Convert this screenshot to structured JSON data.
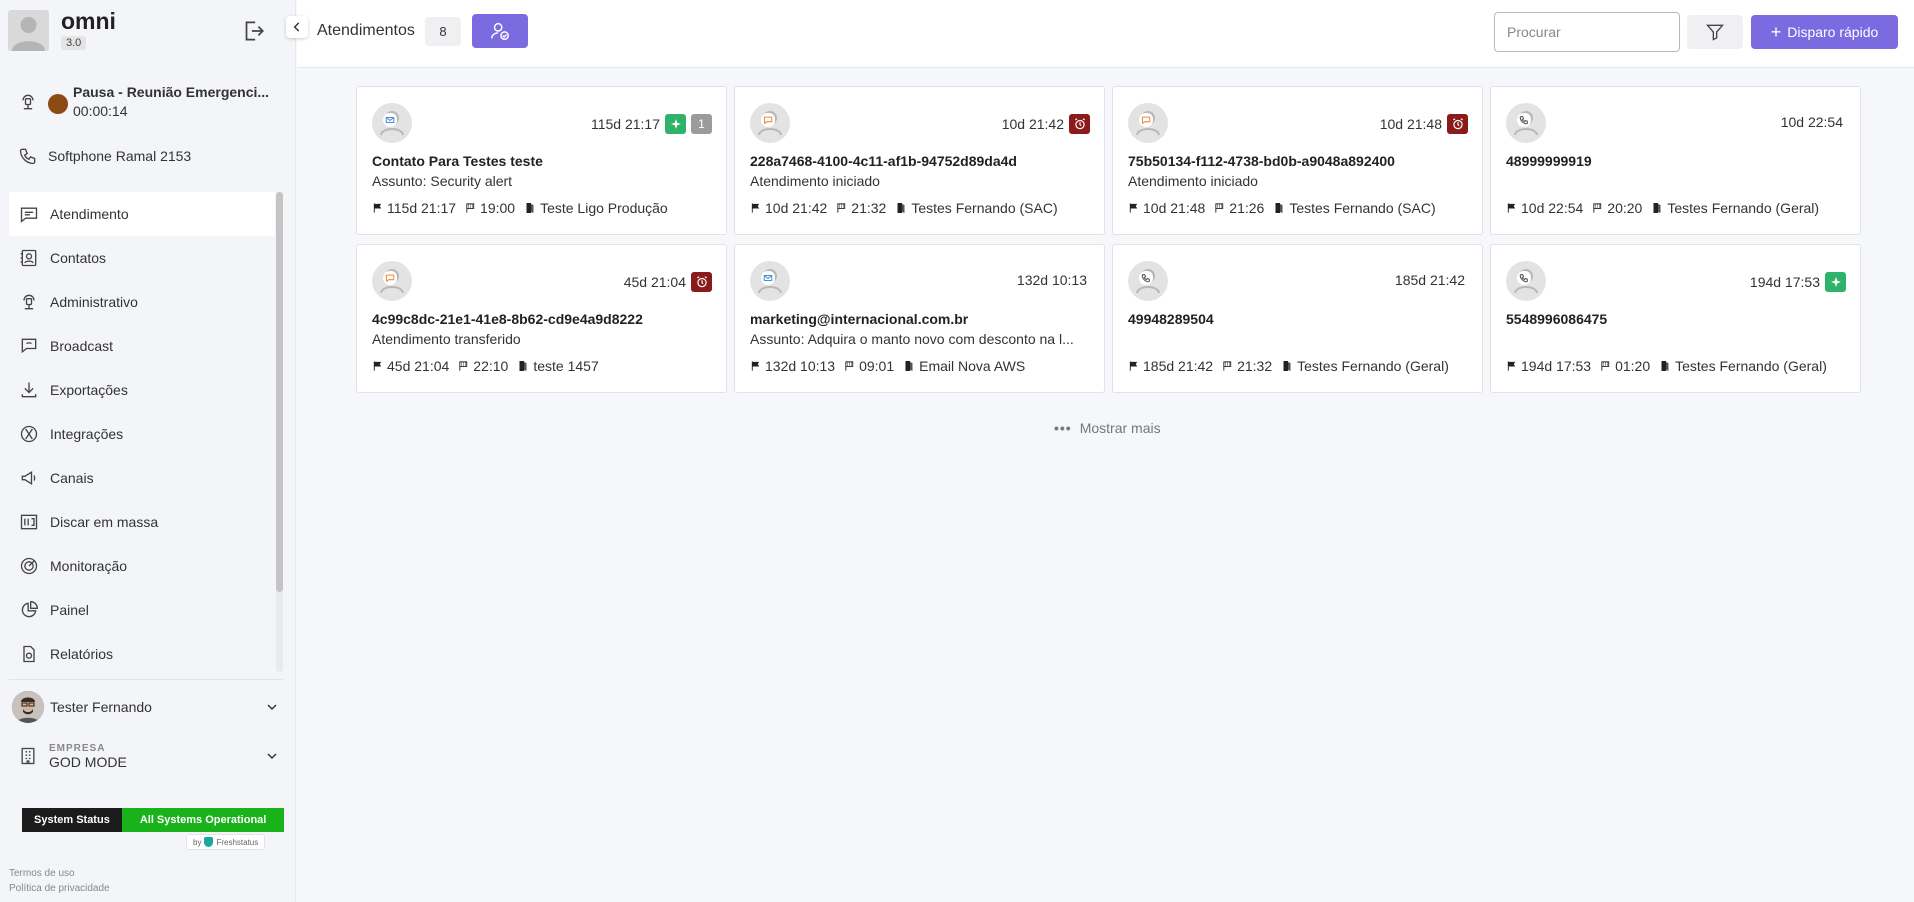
{
  "sidebar": {
    "brand_name": "omni",
    "version": "3.0",
    "pause_status": "Pausa - Reunião Emergenci...",
    "pause_timer": "00:00:14",
    "softphone": "Softphone Ramal 2153",
    "items": [
      {
        "label": "Atendimento",
        "icon": "chat-icon"
      },
      {
        "label": "Contatos",
        "icon": "contact-card-icon"
      },
      {
        "label": "Administrativo",
        "icon": "admin-icon"
      },
      {
        "label": "Broadcast",
        "icon": "broadcast-icon"
      },
      {
        "label": "Exportações",
        "icon": "download-icon"
      },
      {
        "label": "Integrações",
        "icon": "integration-icon"
      },
      {
        "label": "Canais",
        "icon": "megaphone-icon"
      },
      {
        "label": "Discar em massa",
        "icon": "mass-dial-icon"
      },
      {
        "label": "Monitoração",
        "icon": "target-icon"
      },
      {
        "label": "Painel",
        "icon": "pie-chart-icon"
      },
      {
        "label": "Relatórios",
        "icon": "report-icon"
      }
    ],
    "user_name": "Tester Fernando",
    "company_label": "EMPRESA",
    "company_name": "GOD MODE",
    "system_status_label": "System Status",
    "system_status_value": "All Systems Operational",
    "freshstatus_by": "by",
    "freshstatus_name": "Freshstatus",
    "terms": "Termos de uso",
    "privacy": "Política de privacidade"
  },
  "header": {
    "title": "Atendimentos",
    "count": "8",
    "search_placeholder": "Procurar",
    "quick_button": "Disparo rápido"
  },
  "cards": [
    {
      "channel": "email",
      "time": "115d 21:17",
      "badge": "new",
      "count": "1",
      "name": "Contato Para Testes teste",
      "subtitle": "Assunto: Security alert",
      "meta_time": "115d 21:17",
      "meta_flag": "19:00",
      "meta_queue": "Teste Ligo Produção"
    },
    {
      "channel": "chat",
      "time": "10d 21:42",
      "badge": "alarm",
      "name": "228a7468-4100-4c11-af1b-94752d89da4d",
      "subtitle": "Atendimento iniciado",
      "meta_time": "10d 21:42",
      "meta_flag": "21:32",
      "meta_queue": "Testes Fernando (SAC)"
    },
    {
      "channel": "chat",
      "time": "10d 21:48",
      "badge": "alarm",
      "name": "75b50134-f112-4738-bd0b-a9048a892400",
      "subtitle": "Atendimento iniciado",
      "meta_time": "10d 21:48",
      "meta_flag": "21:26",
      "meta_queue": "Testes Fernando (SAC)"
    },
    {
      "channel": "phone",
      "time": "10d 22:54",
      "badge": "",
      "name": "48999999919",
      "subtitle": "",
      "meta_time": "10d 22:54",
      "meta_flag": "20:20",
      "meta_queue": "Testes Fernando (Geral)"
    },
    {
      "channel": "chat",
      "time": "45d 21:04",
      "badge": "alarm",
      "name": "4c99c8dc-21e1-41e8-8b62-cd9e4a9d8222",
      "subtitle": "Atendimento transferido",
      "meta_time": "45d 21:04",
      "meta_flag": "22:10",
      "meta_queue": "teste 1457"
    },
    {
      "channel": "email",
      "time": "132d 10:13",
      "badge": "",
      "name": "marketing@internacional.com.br",
      "subtitle": "Assunto: Adquira o manto novo com desconto na l...",
      "meta_time": "132d 10:13",
      "meta_flag": "09:01",
      "meta_queue": "Email Nova AWS"
    },
    {
      "channel": "phone",
      "time": "185d 21:42",
      "badge": "",
      "name": "49948289504",
      "subtitle": "",
      "meta_time": "185d 21:42",
      "meta_flag": "21:32",
      "meta_queue": "Testes Fernando (Geral)"
    },
    {
      "channel": "phone",
      "time": "194d 17:53",
      "badge": "new",
      "name": "5548996086475",
      "subtitle": "",
      "meta_time": "194d 17:53",
      "meta_flag": "01:20",
      "meta_queue": "Testes Fernando (Geral)"
    }
  ],
  "show_more": "Mostrar mais",
  "colors": {
    "accent": "#7c6ae0",
    "badge_green": "#2fb36a",
    "badge_red": "#8b1a1a",
    "status_dot": "#8b4a12",
    "system_ok": "#1ab21a"
  }
}
